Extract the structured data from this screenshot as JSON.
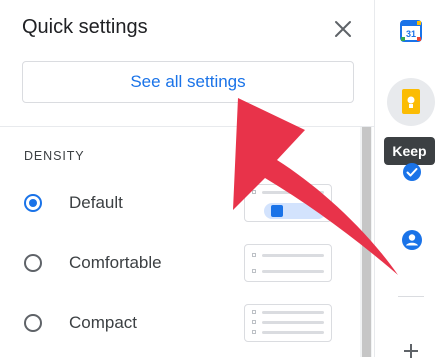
{
  "quick_settings": {
    "title": "Quick settings",
    "see_all_label": "See all settings",
    "density_label": "DENSITY",
    "density_options": [
      {
        "label": "Default",
        "selected": true
      },
      {
        "label": "Comfortable",
        "selected": false
      },
      {
        "label": "Compact",
        "selected": false
      }
    ]
  },
  "side_panel": {
    "calendar_day": "31",
    "tooltip": "Keep",
    "icons": [
      "calendar-icon",
      "keep-icon",
      "tasks-icon",
      "contacts-icon",
      "add-icon"
    ]
  },
  "colors": {
    "accent": "#1a73e8",
    "arrow": "#e8334a",
    "tooltip_bg": "#3c4043"
  }
}
